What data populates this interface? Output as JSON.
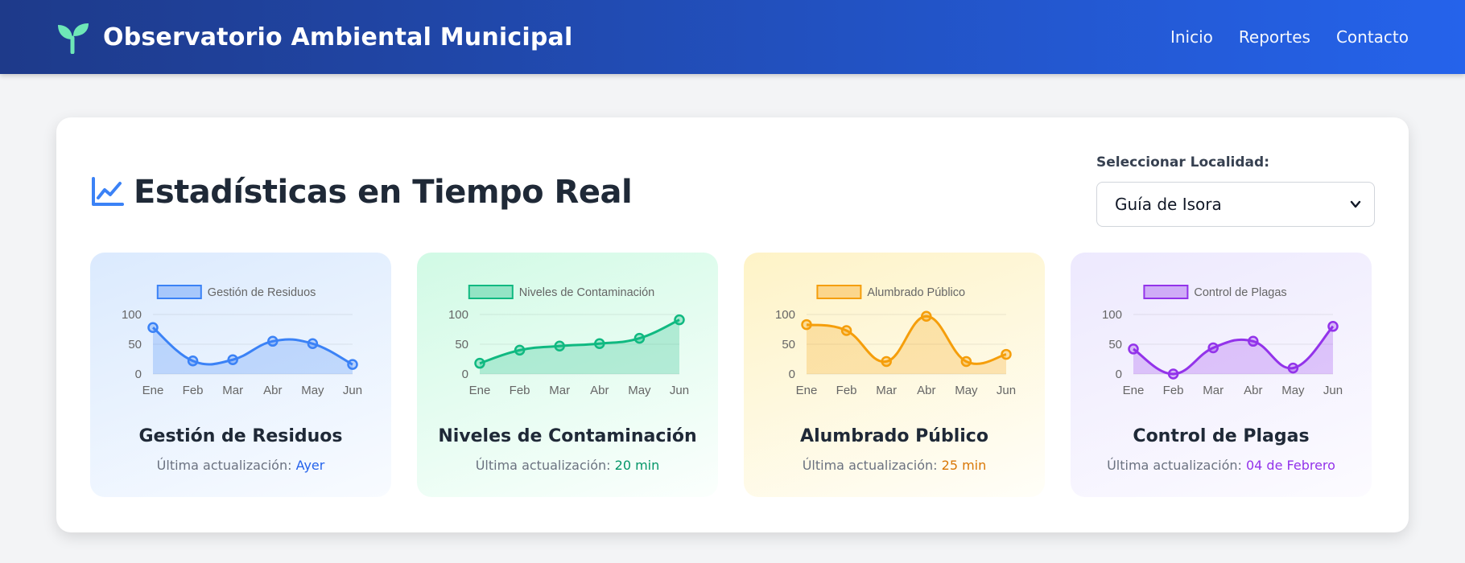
{
  "header": {
    "title": "Observatorio Ambiental Municipal",
    "nav": [
      "Inicio",
      "Reportes",
      "Contacto"
    ]
  },
  "panel": {
    "title": "Estadísticas en Tiempo Real",
    "selector_label": "Seleccionar Localidad:",
    "selected_locality": "Guía de Isora"
  },
  "colors": {
    "blue": "#3b82f6",
    "green": "#10b981",
    "yellow": "#f59e0b",
    "purple": "#9333ea"
  },
  "cards": [
    {
      "title": "Gestión de Residuos",
      "updated_label": "Última actualización: ",
      "updated_value": "Ayer"
    },
    {
      "title": "Niveles de Contaminación",
      "updated_label": "Última actualización: ",
      "updated_value": "20 min"
    },
    {
      "title": "Alumbrado Público",
      "updated_label": "Última actualización: ",
      "updated_value": "25 min"
    },
    {
      "title": "Control de Plagas",
      "updated_label": "Última actualización: ",
      "updated_value": "04 de Febrero"
    }
  ],
  "chart_data": [
    {
      "type": "line",
      "categories": [
        "Ene",
        "Feb",
        "Mar",
        "Abr",
        "May",
        "Jun"
      ],
      "series": [
        {
          "name": "Gestión de Residuos",
          "values": [
            78,
            22,
            24,
            55,
            51,
            16
          ],
          "color": "#3b82f6"
        }
      ],
      "ylim": [
        0,
        100
      ],
      "yticks": [
        0,
        50,
        100
      ],
      "legend": "top"
    },
    {
      "type": "line",
      "categories": [
        "Ene",
        "Feb",
        "Mar",
        "Abr",
        "May",
        "Jun"
      ],
      "series": [
        {
          "name": "Niveles de Contaminación",
          "values": [
            18,
            40,
            47,
            51,
            60,
            91
          ],
          "color": "#10b981"
        }
      ],
      "ylim": [
        0,
        100
      ],
      "yticks": [
        0,
        50,
        100
      ],
      "legend": "top"
    },
    {
      "type": "line",
      "categories": [
        "Ene",
        "Feb",
        "Mar",
        "Abr",
        "May",
        "Jun"
      ],
      "series": [
        {
          "name": "Alumbrado Público",
          "values": [
            83,
            73,
            21,
            97,
            21,
            33
          ],
          "color": "#f59e0b"
        }
      ],
      "ylim": [
        0,
        100
      ],
      "yticks": [
        0,
        50,
        100
      ],
      "legend": "top"
    },
    {
      "type": "line",
      "categories": [
        "Ene",
        "Feb",
        "Mar",
        "Abr",
        "May",
        "Jun"
      ],
      "series": [
        {
          "name": "Control de Plagas",
          "values": [
            42,
            0,
            44,
            55,
            10,
            80
          ],
          "color": "#9333ea"
        }
      ],
      "ylim": [
        0,
        100
      ],
      "yticks": [
        0,
        50,
        100
      ],
      "legend": "top"
    }
  ]
}
